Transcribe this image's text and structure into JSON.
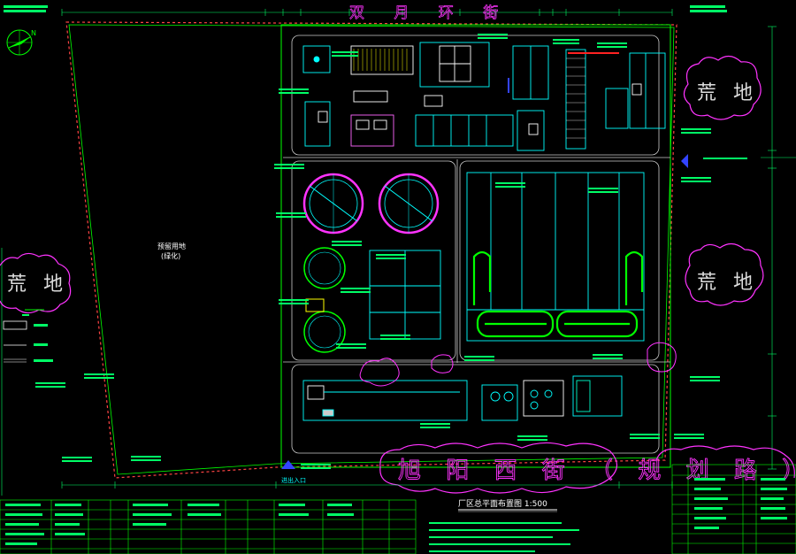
{
  "labels": {
    "wasteland_right_top": "荒 地",
    "wasteland_right_mid": "荒 地",
    "wasteland_left": "荒 地",
    "road_bottom": "旭 阳 西 街 （ 规 划 路 ）",
    "road_top": "双 月 环 街",
    "drawing_title": "厂区总平面布置图 1:500",
    "reserved_land": "预留用地",
    "reserved_land_sub": "(绿化)",
    "plant_entrance": "进出入口"
  },
  "colors": {
    "background": "#000000",
    "boundary": "#00ff00",
    "building": "#00ffff",
    "cloud": "#ff33ff",
    "text_white": "#ffffff",
    "dims": "#00ff66",
    "accent_red": "#ff2222",
    "accent_blue": "#3344ff",
    "accent_yellow": "#ffff00"
  },
  "icons": {
    "north_arrow": "north-arrow-icon",
    "legend": "legend-swatches"
  }
}
